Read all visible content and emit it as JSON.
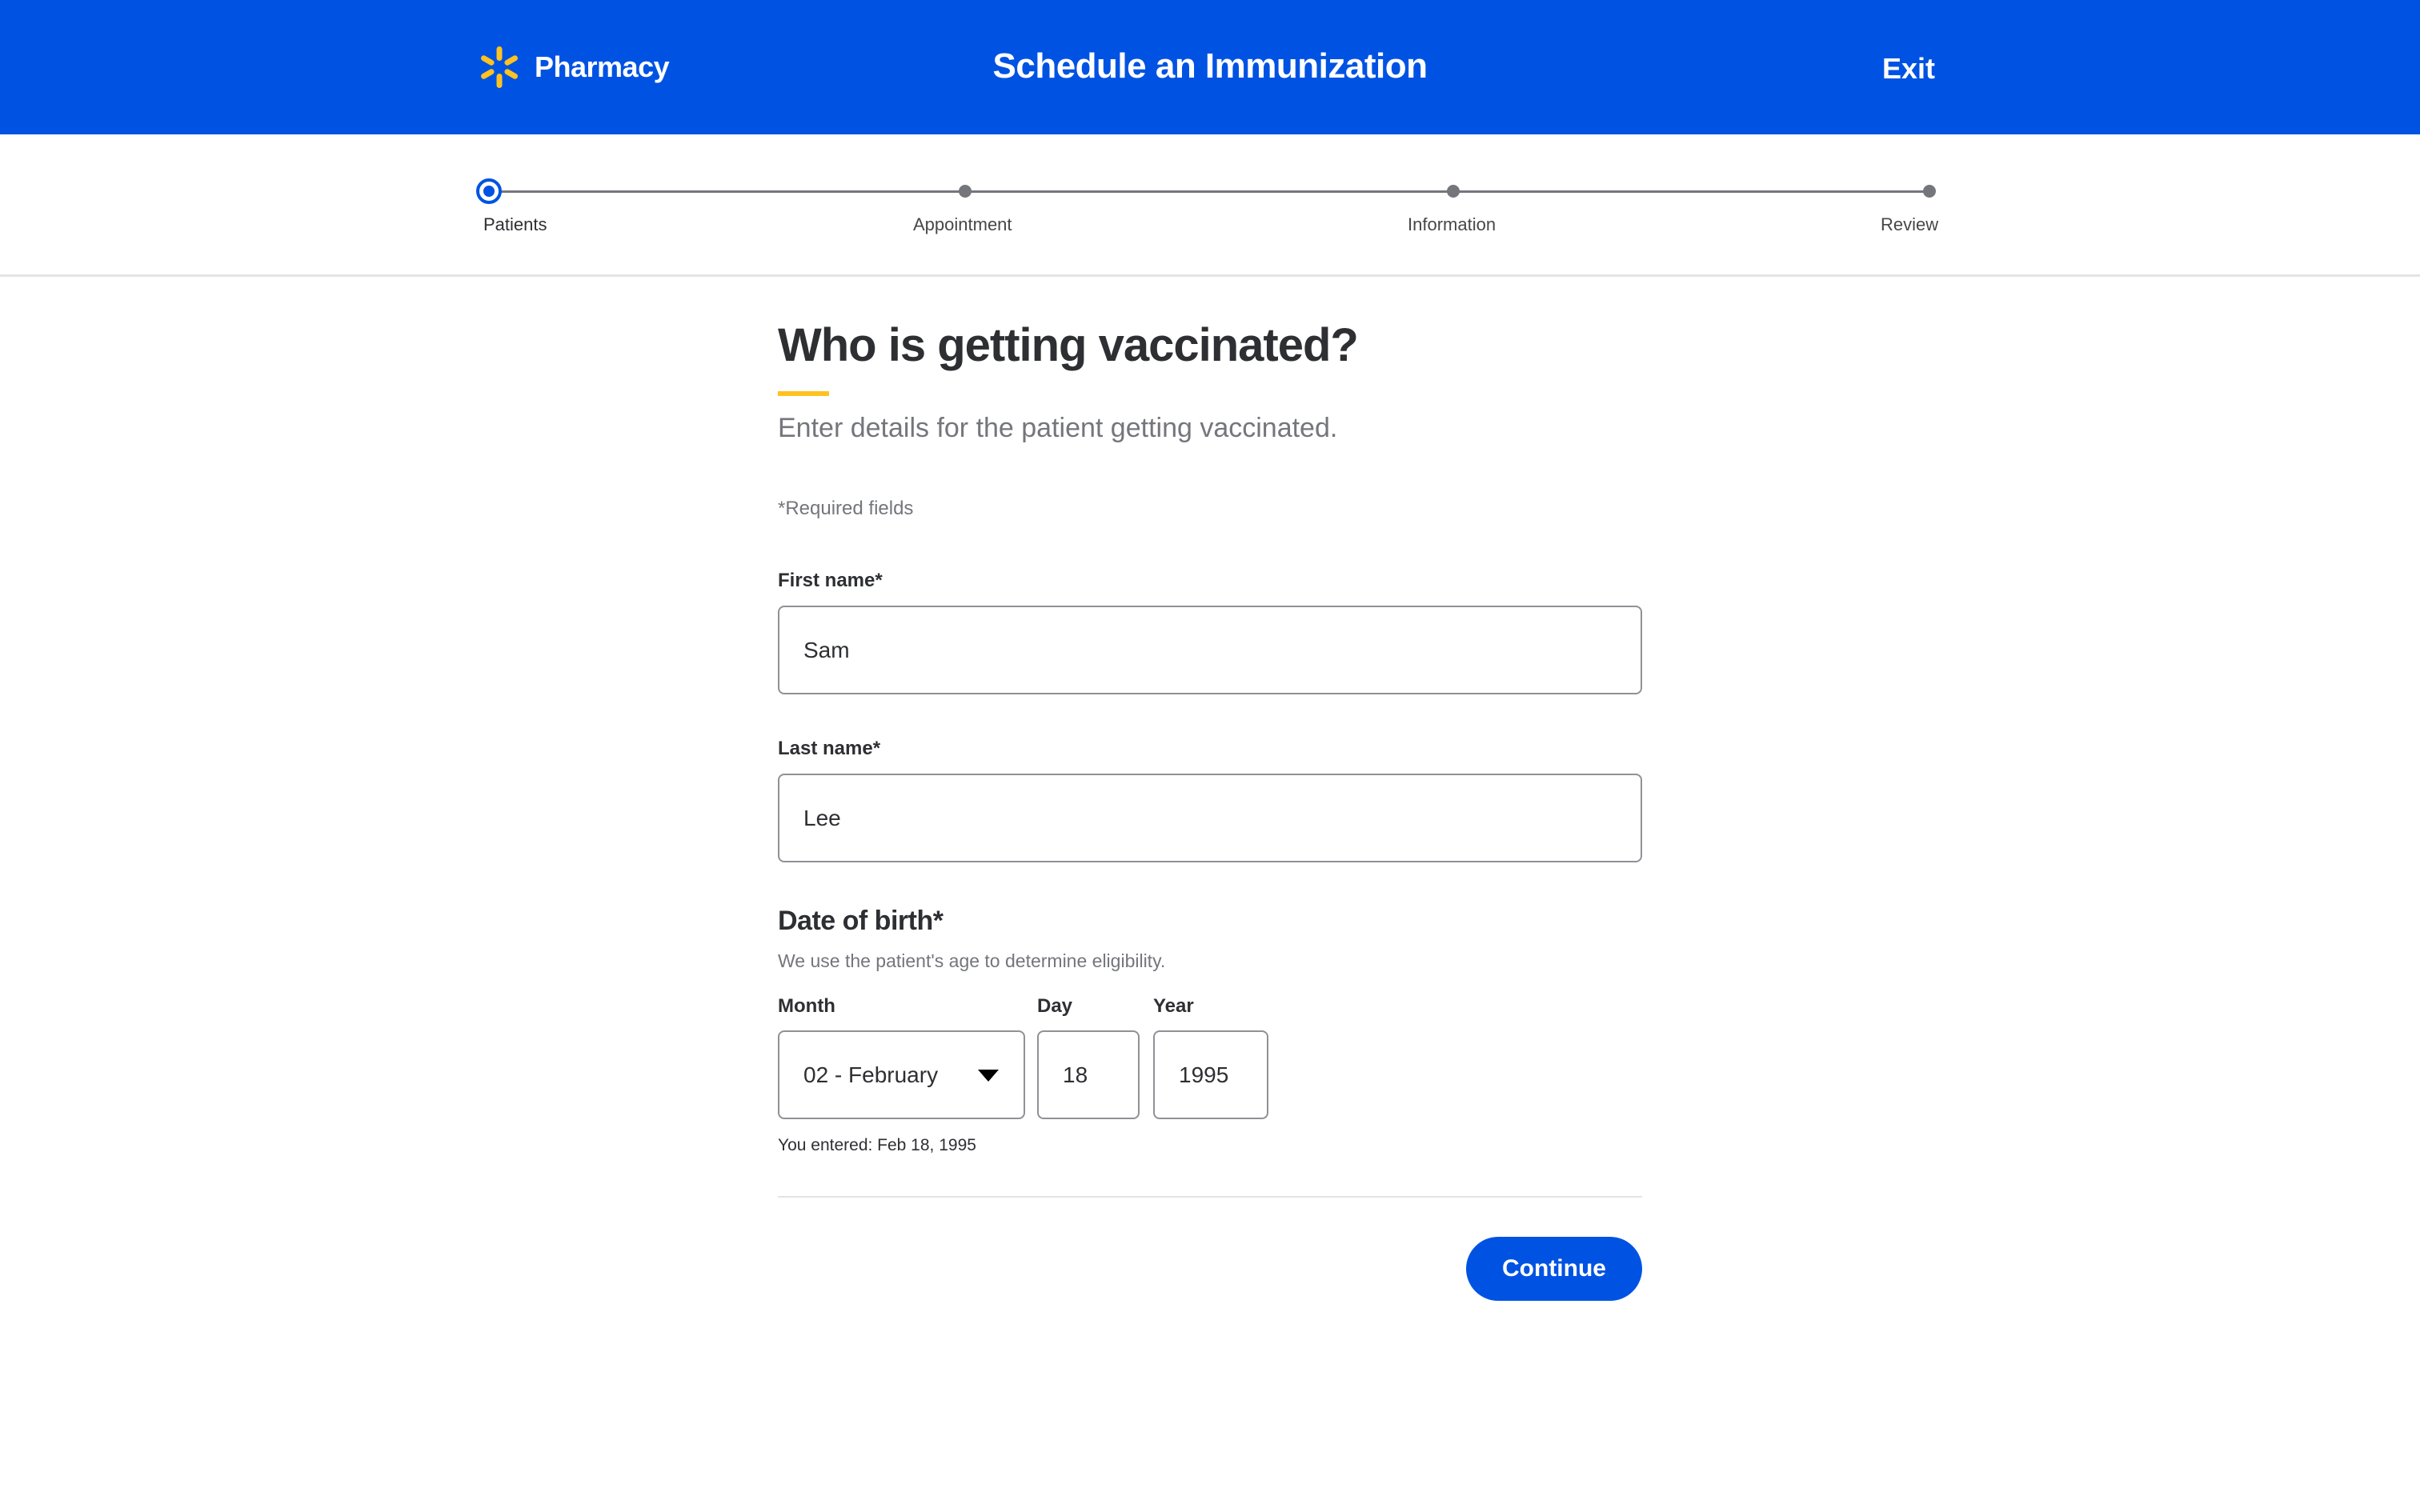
{
  "header": {
    "brand_name": "Pharmacy",
    "title": "Schedule an Immunization",
    "exit_label": "Exit",
    "logo_icon": "walmart-spark-icon",
    "colors": {
      "header_bg": "#0053e2",
      "spark": "#ffc220"
    }
  },
  "progress": {
    "current_step": 0,
    "steps": [
      {
        "label": "Patients"
      },
      {
        "label": "Appointment"
      },
      {
        "label": "Information"
      },
      {
        "label": "Review"
      }
    ]
  },
  "form": {
    "heading": "Who is getting vaccinated?",
    "subheading": "Enter details for the patient getting vaccinated.",
    "required_note": "*Required fields",
    "first_name": {
      "label": "First name*",
      "value": "Sam"
    },
    "last_name": {
      "label": "Last name*",
      "value": "Lee"
    },
    "dob": {
      "heading": "Date of birth*",
      "help": "We use the patient's age to determine eligibility.",
      "month": {
        "label": "Month",
        "value": "02 - February"
      },
      "day": {
        "label": "Day",
        "value": "18"
      },
      "year": {
        "label": "Year",
        "value": "1995"
      },
      "entered_note": "You entered: Feb 18, 1995"
    },
    "continue_label": "Continue",
    "colors": {
      "accent": "#0053e2",
      "underline": "#ffc220"
    }
  }
}
